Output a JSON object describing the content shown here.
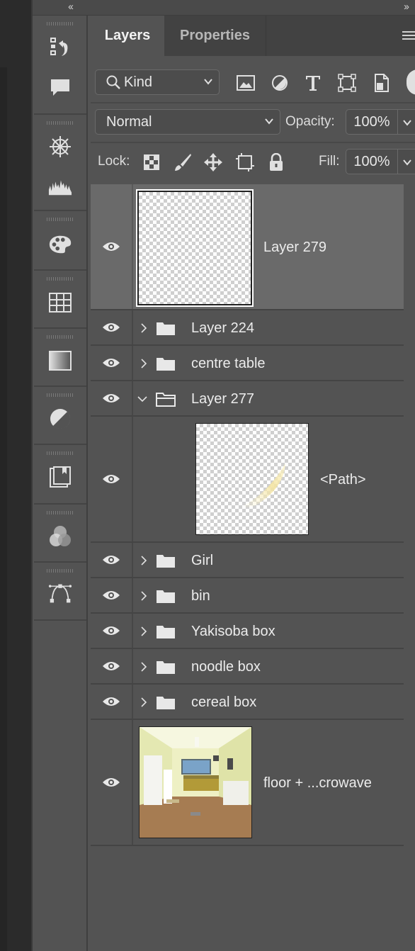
{
  "tabs": {
    "layers": "Layers",
    "properties": "Properties"
  },
  "filter": {
    "kind_label": "Kind"
  },
  "blend": {
    "mode": "Normal",
    "opacity_label": "Opacity:",
    "opacity_value": "100%"
  },
  "lock": {
    "label": "Lock:",
    "fill_label": "Fill:",
    "fill_value": "100%"
  },
  "layers": [
    {
      "name": "Layer 279",
      "type": "pixel",
      "selected": true
    },
    {
      "name": "Layer 224",
      "type": "group",
      "expanded": false
    },
    {
      "name": "centre table",
      "type": "group",
      "expanded": false
    },
    {
      "name": "Layer 277",
      "type": "group",
      "expanded": true
    },
    {
      "name": "<Path>",
      "type": "pixel-child"
    },
    {
      "name": "Girl",
      "type": "group",
      "expanded": false
    },
    {
      "name": "bin",
      "type": "group",
      "expanded": false
    },
    {
      "name": "Yakisoba box",
      "type": "group",
      "expanded": false
    },
    {
      "name": "noodle box",
      "type": "group",
      "expanded": false
    },
    {
      "name": "cereal box",
      "type": "group",
      "expanded": false
    },
    {
      "name": "floor + ...crowave",
      "type": "pixel"
    }
  ],
  "colors": {
    "panel": "#535353",
    "selected_row": "#6a6a6a",
    "tab_bar": "#424242",
    "text": "#ececec"
  }
}
